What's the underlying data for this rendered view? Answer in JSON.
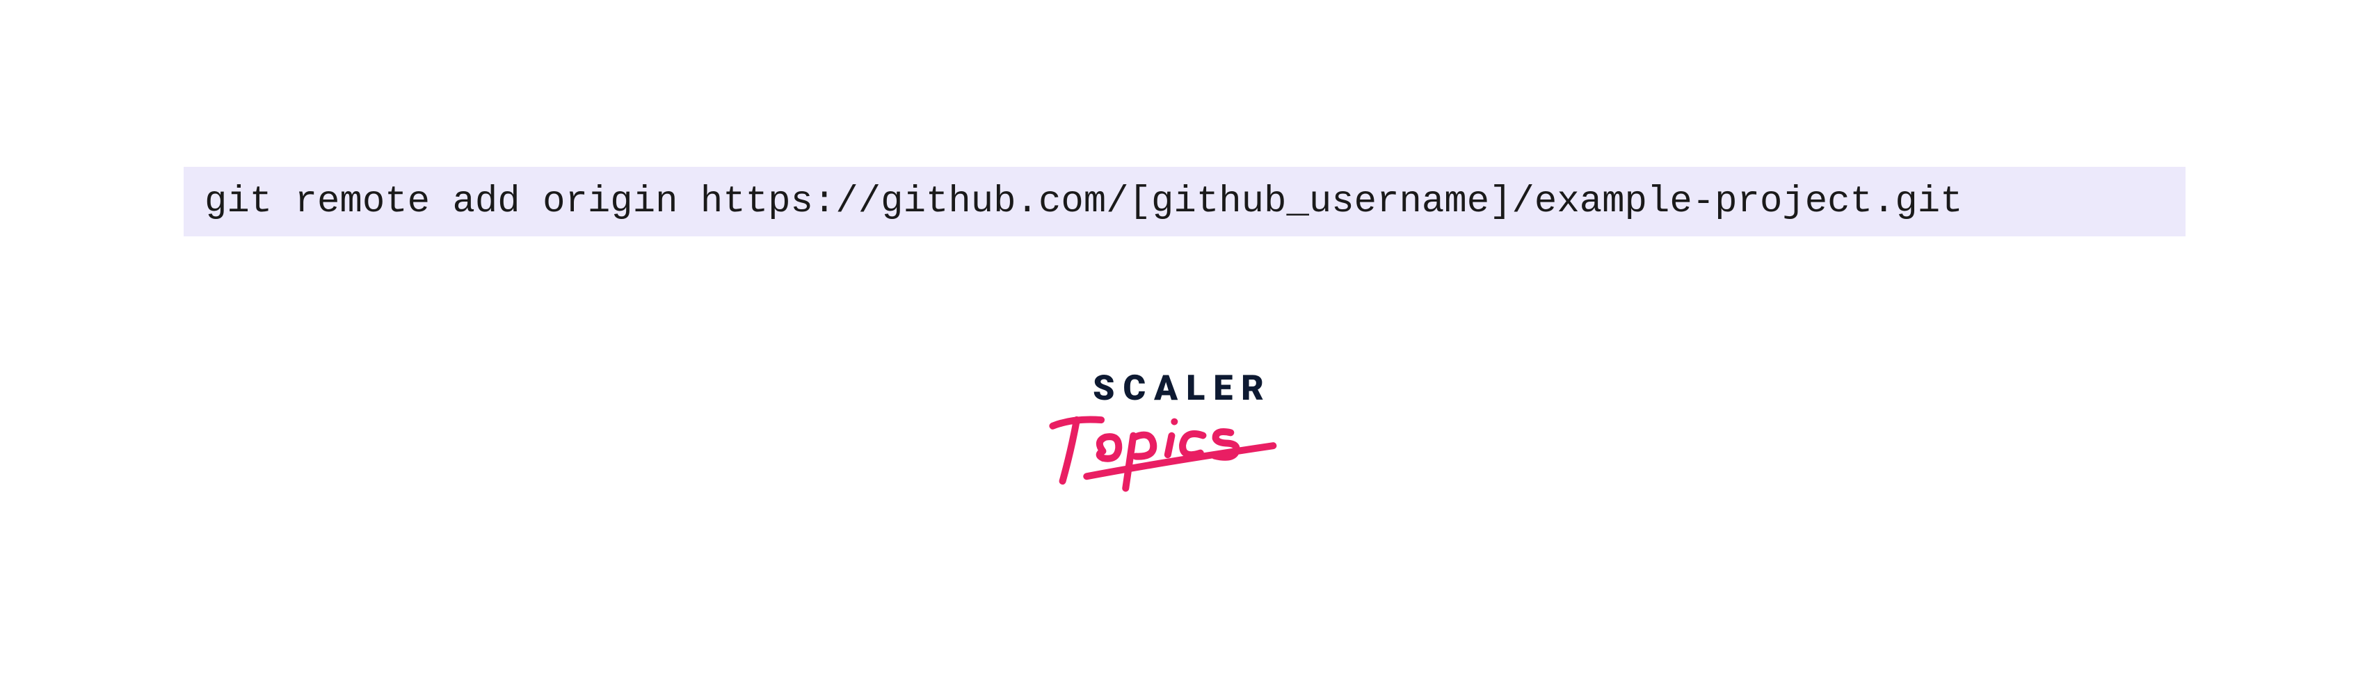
{
  "code": {
    "command": "git remote add origin https://github.com/[github_username]/example-project.git"
  },
  "logo": {
    "line1": "SCALER",
    "line2": "Topics"
  },
  "colors": {
    "code_bg": "#ece9fb",
    "code_text": "#1a1a1a",
    "scaler_text": "#0e1a32",
    "topics_text": "#e91e63"
  }
}
